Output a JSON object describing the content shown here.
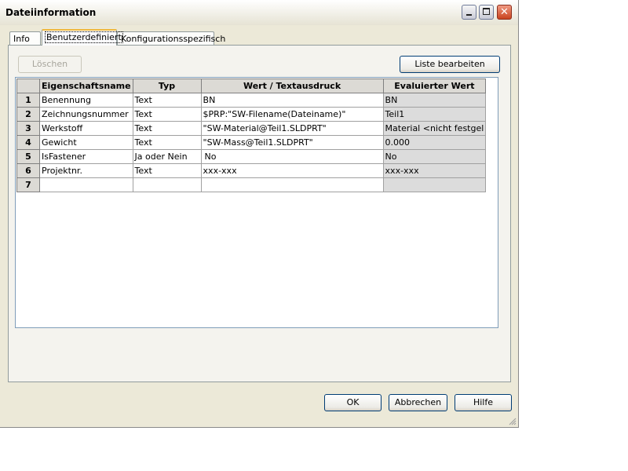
{
  "window": {
    "title": "Dateiinformation"
  },
  "titlebar_buttons": {
    "minimize": "minimize-icon",
    "maximize": "maximize-icon",
    "close": "close-icon",
    "close_glyph": "✕"
  },
  "tabs": [
    {
      "label": "Info",
      "active": false
    },
    {
      "label": "Benutzerdefiniert",
      "active": true
    },
    {
      "label": "Konfigurationsspezifisch",
      "active": false
    }
  ],
  "toolbar": {
    "delete_label": "Löschen",
    "edit_list_label": "Liste bearbeiten"
  },
  "table": {
    "columns": [
      "Eigenschaftsname",
      "Typ",
      "Wert / Textausdruck",
      "Evaluierter Wert"
    ],
    "rows": [
      {
        "num": "1",
        "name": "Benennung",
        "type": "Text",
        "value": "BN",
        "evaluated": "BN"
      },
      {
        "num": "2",
        "name": "Zeichnungsnummer",
        "type": "Text",
        "value": "$PRP:\"SW-Filename(Dateiname)\"",
        "evaluated": "Teil1"
      },
      {
        "num": "3",
        "name": "Werkstoff",
        "type": "Text",
        "value": "\"SW-Material@Teil1.SLDPRT\"",
        "evaluated": "Material <nicht festgel"
      },
      {
        "num": "4",
        "name": "Gewicht",
        "type": "Text",
        "value": "\"SW-Mass@Teil1.SLDPRT\"",
        "evaluated": "0.000"
      },
      {
        "num": "5",
        "name": "IsFastener",
        "type": "Ja oder Nein",
        "value": "No",
        "evaluated": "No"
      },
      {
        "num": "6",
        "name": "Projektnr.",
        "type": "Text",
        "value": "xxx-xxx",
        "evaluated": "xxx-xxx"
      },
      {
        "num": "7",
        "name": "",
        "type": "",
        "value": "",
        "evaluated": ""
      }
    ]
  },
  "footer": {
    "ok_label": "OK",
    "cancel_label": "Abbrechen",
    "help_label": "Hilfe"
  },
  "colors": {
    "accent_tab": "#f0b83e",
    "dialog_bg": "#ece9d8",
    "button_border": "#003c74"
  }
}
